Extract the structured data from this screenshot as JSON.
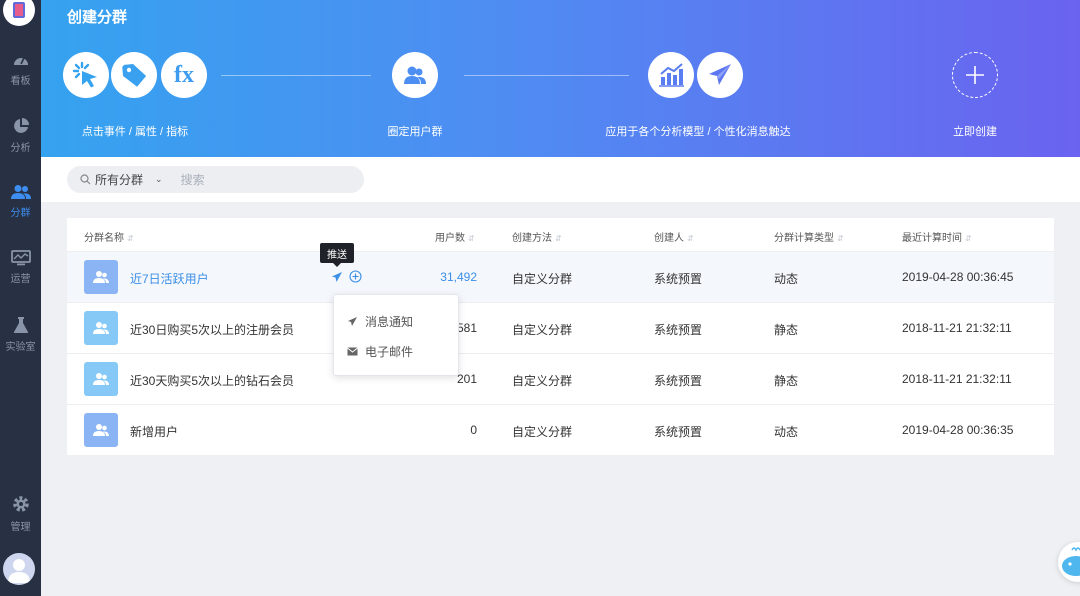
{
  "sidebar": {
    "items": [
      {
        "label": "看板",
        "icon": "dashboard-icon"
      },
      {
        "label": "分析",
        "icon": "pie-chart-icon"
      },
      {
        "label": "分群",
        "icon": "users-icon",
        "active": true
      },
      {
        "label": "运营",
        "icon": "monitor-icon"
      },
      {
        "label": "实验室",
        "icon": "flask-icon"
      }
    ],
    "settings": {
      "label": "管理",
      "icon": "gear-icon"
    }
  },
  "banner": {
    "title": "创建分群",
    "steps": [
      {
        "label": "点击事件 / 属性 / 指标"
      },
      {
        "label": "圈定用户群"
      },
      {
        "label": "应用于各个分析模型 / 个性化消息触达"
      },
      {
        "label": "立即创建"
      }
    ],
    "fx_text": "fx"
  },
  "filter": {
    "scope": "所有分群",
    "placeholder": "搜索"
  },
  "table": {
    "columns": [
      "分群名称",
      "用户数",
      "创建方法",
      "创建人",
      "分群计算类型",
      "最近计算时间"
    ],
    "rows": [
      {
        "name": "近7日活跃用户",
        "users": "31,492",
        "method": "自定义分群",
        "creator": "系统预置",
        "type": "动态",
        "time": "2019-04-28 00:36:45"
      },
      {
        "name": "近30日购买5次以上的注册会员",
        "users": "581",
        "method": "自定义分群",
        "creator": "系统预置",
        "type": "静态",
        "time": "2018-11-21 21:32:11"
      },
      {
        "name": "近30天购买5次以上的钻石会员",
        "users": "201",
        "method": "自定义分群",
        "creator": "系统预置",
        "type": "静态",
        "time": "2018-11-21 21:32:11"
      },
      {
        "name": "新增用户",
        "users": "0",
        "method": "自定义分群",
        "creator": "系统预置",
        "type": "动态",
        "time": "2019-04-28 00:36:35"
      }
    ]
  },
  "tooltip": {
    "text": "推送"
  },
  "push_menu": {
    "items": [
      {
        "label": "消息通知",
        "icon": "send-icon"
      },
      {
        "label": "电子邮件",
        "icon": "mail-icon"
      }
    ]
  },
  "colors": {
    "sidebar_bg": "#283143",
    "accent": "#3b8fe6",
    "banner_start": "#35a3ef",
    "banner_end": "#6a63f0"
  }
}
